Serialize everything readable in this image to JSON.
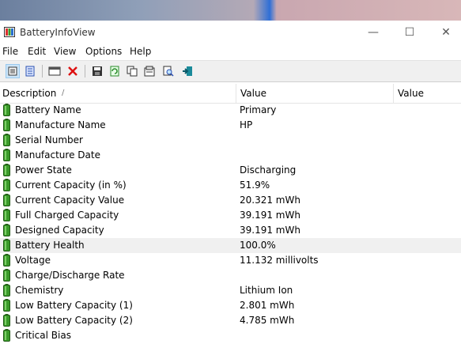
{
  "window": {
    "title": "BatteryInfoView",
    "minimize_glyph": "—",
    "maximize_glyph": "☐",
    "close_glyph": "✕"
  },
  "menu": [
    "File",
    "Edit",
    "View",
    "Options",
    "Help"
  ],
  "toolbar": {
    "icons": [
      "list-view-icon",
      "html-report-icon",
      "window-icon",
      "delete-icon",
      "save-icon",
      "refresh-icon",
      "copy-icon",
      "properties-icon",
      "find-icon",
      "exit-icon"
    ]
  },
  "columns": {
    "description": "Description",
    "sort_indicator": "/",
    "value1": "Value",
    "value2": "Value"
  },
  "rows": [
    {
      "desc": "Battery Name",
      "value": "Primary"
    },
    {
      "desc": "Manufacture Name",
      "value": "HP"
    },
    {
      "desc": "Serial Number",
      "value": ""
    },
    {
      "desc": "Manufacture Date",
      "value": ""
    },
    {
      "desc": "Power State",
      "value": "Discharging"
    },
    {
      "desc": "Current Capacity (in %)",
      "value": "51.9%"
    },
    {
      "desc": "Current Capacity Value",
      "value": "20.321 mWh"
    },
    {
      "desc": "Full Charged Capacity",
      "value": "39.191 mWh"
    },
    {
      "desc": "Designed Capacity",
      "value": "39.191 mWh"
    },
    {
      "desc": "Battery Health",
      "value": "100.0%"
    },
    {
      "desc": "Voltage",
      "value": "11.132 millivolts"
    },
    {
      "desc": "Charge/Discharge Rate",
      "value": ""
    },
    {
      "desc": "Chemistry",
      "value": "Lithium Ion"
    },
    {
      "desc": "Low Battery Capacity (1)",
      "value": "2.801 mWh"
    },
    {
      "desc": "Low Battery Capacity (2)",
      "value": "4.785 mWh"
    },
    {
      "desc": "Critical Bias",
      "value": ""
    }
  ],
  "selected_row": "Battery Health",
  "colors": {
    "battery_green": "#3a9a2a",
    "selection": "#f0f0f0"
  }
}
